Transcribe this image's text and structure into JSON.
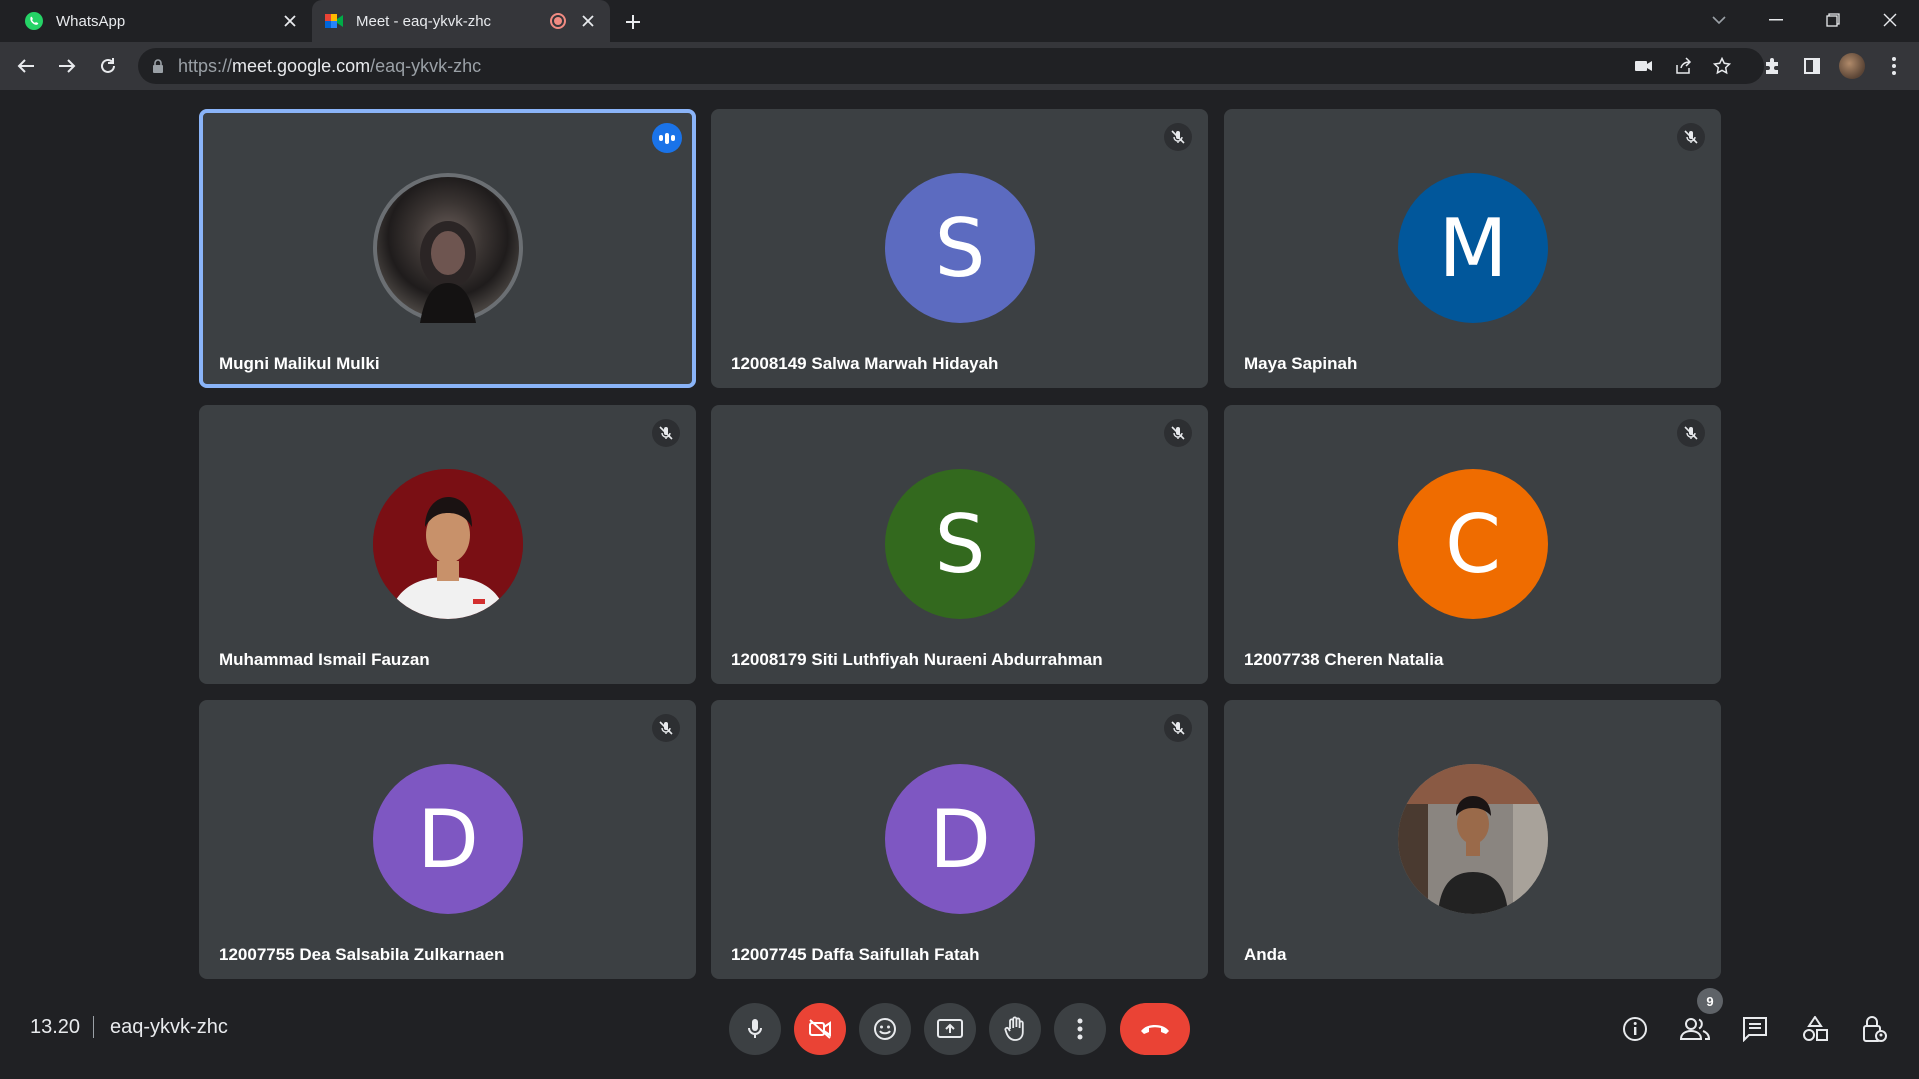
{
  "tabs": [
    {
      "title": "WhatsApp",
      "icon": "whatsapp-icon"
    },
    {
      "title": "Meet - eaq-ykvk-zhc",
      "icon": "google-meet-icon",
      "recording": true
    }
  ],
  "address_bar": {
    "scheme": "https://",
    "host": "meet.google.com",
    "path": "/eaq-ykvk-zhc"
  },
  "participants": [
    {
      "name": "Mugni Malikul Mulki",
      "avatar": "photo",
      "speaking": true,
      "muted": false
    },
    {
      "name": "12008149 Salwa Marwah Hidayah",
      "initial": "S",
      "color": "#5c6bc0",
      "muted": true
    },
    {
      "name": "Maya Sapinah",
      "initial": "M",
      "color": "#01579b",
      "muted": true
    },
    {
      "name": "Muhammad Ismail Fauzan",
      "avatar": "photo",
      "muted": true
    },
    {
      "name": "12008179 Siti Luthfiyah Nuraeni Abdurrahman",
      "initial": "S",
      "color": "#33691e",
      "muted": true
    },
    {
      "name": "12007738 Cheren Natalia",
      "initial": "C",
      "color": "#ef6c00",
      "muted": true
    },
    {
      "name": "12007755 Dea Salsabila Zulkarnaen",
      "initial": "D",
      "color": "#7e57c2",
      "muted": true
    },
    {
      "name": "12007745 Daffa Saifullah Fatah",
      "initial": "D",
      "color": "#7e57c2",
      "muted": true
    },
    {
      "name": "Anda",
      "avatar": "photo",
      "muted": false
    }
  ],
  "bottom_bar": {
    "time": "13.20",
    "meeting_code": "eaq-ykvk-zhc",
    "people_count": "9"
  },
  "colors": {
    "accent": "#8ab4f8",
    "danger": "#ea4335",
    "tile_bg": "#3c4043",
    "page_bg": "#202124"
  }
}
